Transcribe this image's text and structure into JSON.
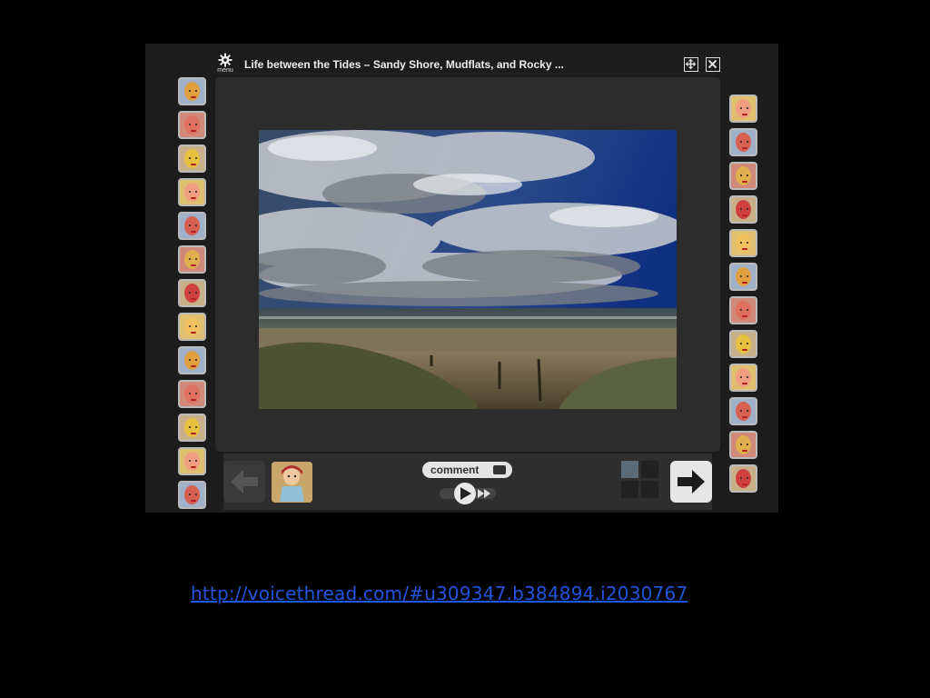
{
  "player": {
    "menu_label": "menu",
    "title": "Life between the Tides – Sandy Shore, Mudflats, and Rocky ...",
    "icons": {
      "menu": "gear-icon",
      "expand": "expand-icon",
      "close": "close-icon"
    }
  },
  "controls": {
    "comment_label": "comment",
    "icons": {
      "prev": "arrow-left-icon",
      "next": "arrow-right-icon",
      "play": "play-icon",
      "fast_forward": "fast-forward-icon",
      "comment": "speech-bubble-icon",
      "thumbnails": "thumbnail-grid-icon"
    }
  },
  "footer": {
    "link_text": "http://voicethread.com/#u309347.b384894.i2030767"
  },
  "colors": {
    "background": "#000000",
    "panel": "#1c1c1c",
    "stage": "#2c2c2c",
    "link": "#2255dd",
    "button": "#e6e6e6"
  }
}
